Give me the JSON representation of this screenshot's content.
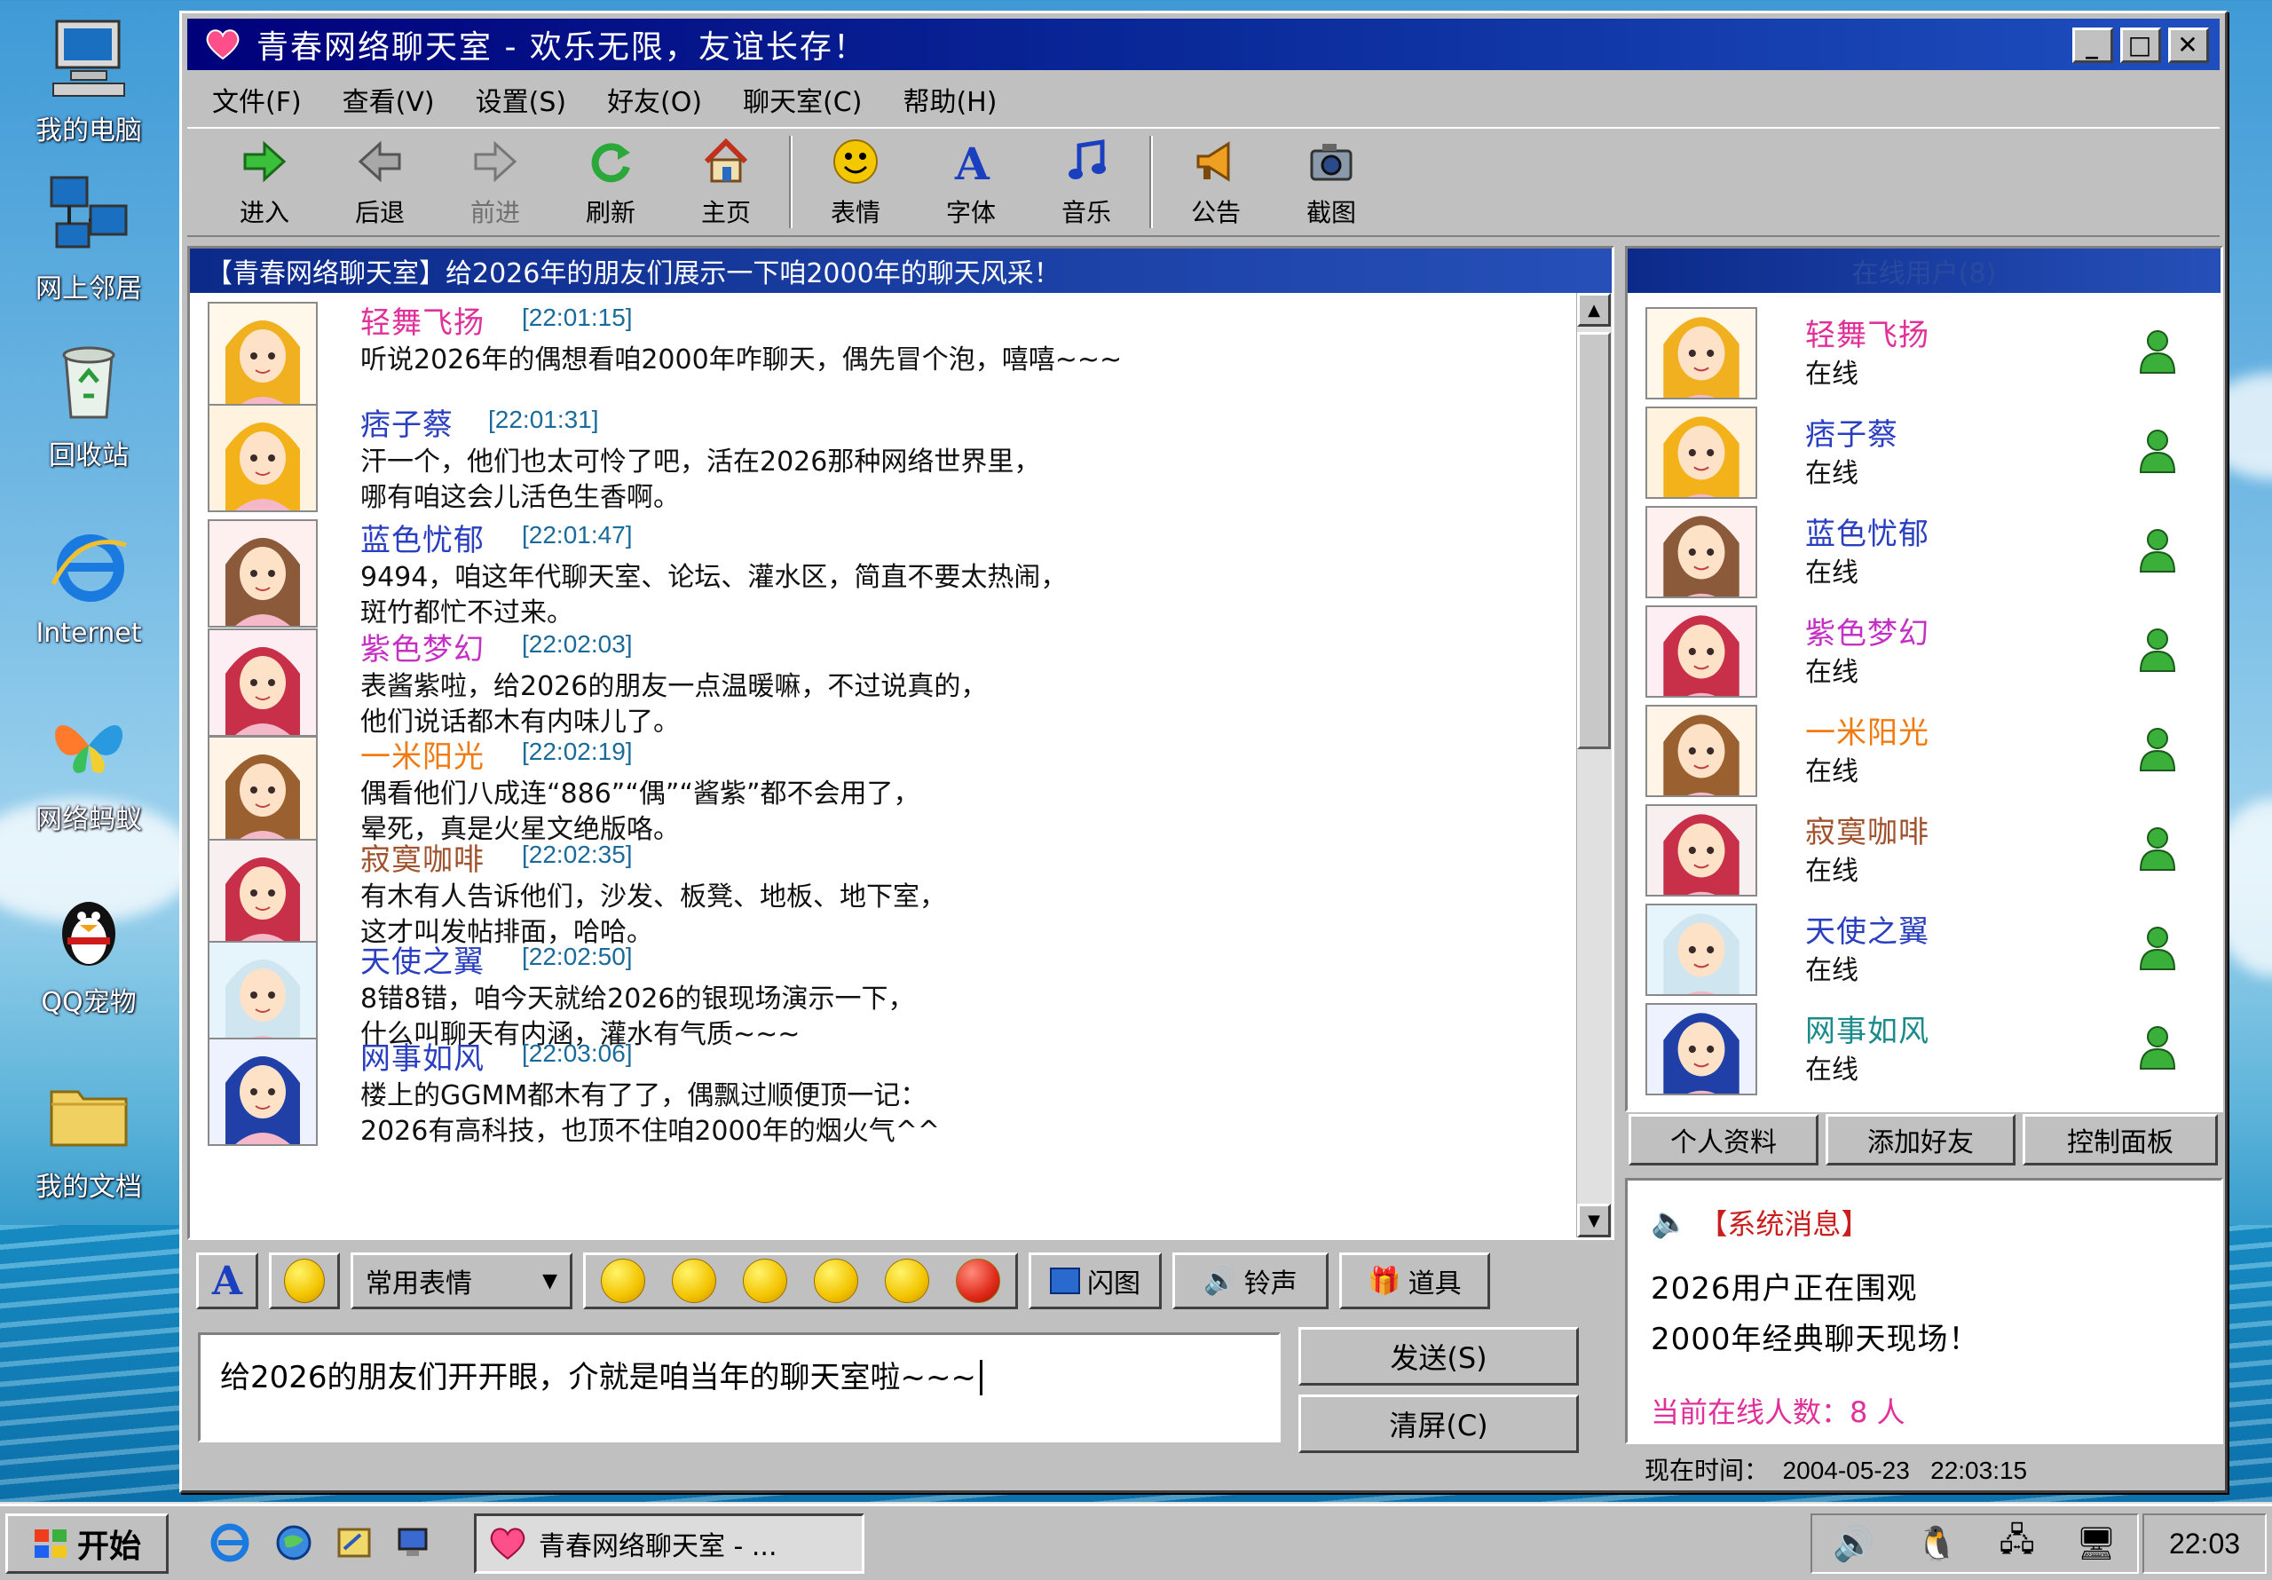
{
  "desktop": {
    "icons": [
      {
        "label": "我的电脑",
        "icon": "computer-icon"
      },
      {
        "label": "网上邻居",
        "icon": "network-icon"
      },
      {
        "label": "回收站",
        "icon": "recycle-bin-icon"
      },
      {
        "label": "Internet",
        "icon": "ie-icon"
      },
      {
        "label": "网络蚂蚁",
        "icon": "butterfly-icon"
      },
      {
        "label": "QQ宠物",
        "icon": "penguin-icon"
      },
      {
        "label": "我的文档",
        "icon": "folder-icon"
      }
    ]
  },
  "window": {
    "title": "青春网络聊天室 - 欢乐无限，友谊长存！",
    "controls": [
      "_",
      "□",
      "✕"
    ]
  },
  "menu": [
    "文件(F)",
    "查看(V)",
    "设置(S)",
    "好友(O)",
    "聊天室(C)",
    "帮助(H)"
  ],
  "toolbar": [
    {
      "label": "进入",
      "icon": "enter-arrow-icon"
    },
    {
      "label": "后退",
      "icon": "back-arrow-icon"
    },
    {
      "label": "前进",
      "icon": "forward-arrow-icon"
    },
    {
      "label": "刷新",
      "icon": "refresh-icon"
    },
    {
      "label": "主页",
      "icon": "home-icon"
    },
    {
      "label": "表情",
      "icon": "smiley-icon"
    },
    {
      "label": "字体",
      "icon": "font-icon"
    },
    {
      "label": "音乐",
      "icon": "music-note-icon"
    },
    {
      "label": "公告",
      "icon": "megaphone-icon"
    },
    {
      "label": "截图",
      "icon": "camera-icon"
    }
  ],
  "chat": {
    "header": "【青春网络聊天室】给2026年的朋友们展示一下咱2000年的聊天风采！",
    "messages": [
      {
        "name": "轻舞飞扬",
        "time": "[22:01:15]",
        "color": "#e0309a",
        "lines": "听说2026年的偶想看咱2000年咋聊天，偶先冒个泡，嘻嘻~~~",
        "hair": "#f0b020"
      },
      {
        "name": "痞子蔡",
        "time": "[22:01:31]",
        "color": "#2a3fc0",
        "lines": "汗一个，他们也太可怜了吧，活在2026那种网络世界里，\n哪有咱这会儿活色生香啊。",
        "hair": "#f4b21a"
      },
      {
        "name": "蓝色忧郁",
        "time": "[22:01:47]",
        "color": "#2a3fc0",
        "lines": "9494，咱这年代聊天室、论坛、灌水区，简直不要太热闹，\n斑竹都忙不过来。",
        "hair": "#8a5a3a"
      },
      {
        "name": "紫色梦幻",
        "time": "[22:02:03]",
        "color": "#c430c4",
        "lines": "表酱紫啦，给2026的朋友一点温暖嘛，不过说真的，\n他们说话都木有内味儿了。",
        "hair": "#c8304a"
      },
      {
        "name": "一米阳光",
        "time": "[22:02:19]",
        "color": "#f07a10",
        "lines": "偶看他们八成连“886”“偶”“酱紫”都不会用了，\n晕死，真是火星文绝版咯。",
        "hair": "#9a6030"
      },
      {
        "name": "寂寞咖啡",
        "time": "[22:02:35]",
        "color": "#a0522d",
        "lines": "有木有人告诉他们，沙发、板凳、地板、地下室，\n这才叫发帖排面，哈哈。",
        "hair": "#c8304a"
      },
      {
        "name": "天使之翼",
        "time": "[22:02:50]",
        "color": "#2a3fc0",
        "lines": "8错8错，咱今天就给2026的银现场演示一下，\n什么叫聊天有内涵，灌水有气质~~~",
        "hair": "#cfe6f0"
      },
      {
        "name": "网事如风",
        "time": "[22:03:06]",
        "color": "#2a3fc0",
        "lines": "楼上的GGMM都木有了了，偶飘过顺便顶一记：\n2026有高科技，也顶不住咱2000年的烟火气^^",
        "hair": "#2040a8"
      }
    ]
  },
  "inputbar": {
    "font_btn": "A",
    "common_emotes": "常用表情",
    "flash_pic": "闪图",
    "ringtone": "铃声",
    "props": "道具"
  },
  "input": {
    "value": "给2026的朋友们开开眼，介就是咱当年的聊天室啦~~~",
    "send": "发送(S)",
    "clear": "清屏(C)"
  },
  "users": {
    "header": "在线用户(8)",
    "list": [
      {
        "name": "轻舞飞扬",
        "status": "在线",
        "color": "#e0309a",
        "hair": "#f0b020"
      },
      {
        "name": "痞子蔡",
        "status": "在线",
        "color": "#2a3fc0",
        "hair": "#f4b21a"
      },
      {
        "name": "蓝色忧郁",
        "status": "在线",
        "color": "#2a3fc0",
        "hair": "#8a5a3a"
      },
      {
        "name": "紫色梦幻",
        "status": "在线",
        "color": "#c430c4",
        "hair": "#c8304a"
      },
      {
        "name": "一米阳光",
        "status": "在线",
        "color": "#f07a10",
        "hair": "#9a6030"
      },
      {
        "name": "寂寞咖啡",
        "status": "在线",
        "color": "#a0522d",
        "hair": "#c8304a"
      },
      {
        "name": "天使之翼",
        "status": "在线",
        "color": "#2a3fc0",
        "hair": "#cfe6f0"
      },
      {
        "name": "网事如风",
        "status": "在线",
        "color": "#1a8a8a",
        "hair": "#2040a8"
      }
    ],
    "buttons": [
      "个人资料",
      "添加好友",
      "控制面板"
    ]
  },
  "system": {
    "title": "【系统消息】",
    "line1": "2026用户正在围观",
    "line2": "2000年经典聊天现场！",
    "online_count": "当前在线人数：8 人"
  },
  "status": {
    "time": "现在时间：  2004-05-23   22:03:15"
  },
  "taskbar": {
    "start": "开始",
    "task": "青春网络聊天室 - ...",
    "clock": "22:03"
  }
}
